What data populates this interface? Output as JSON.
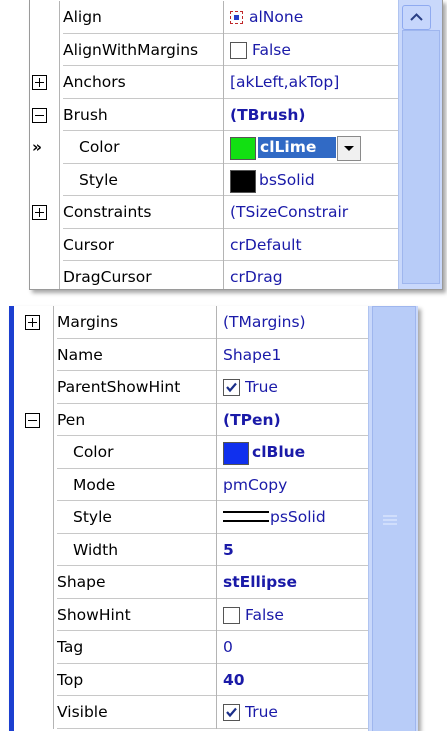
{
  "top_panel": {
    "rows": [
      {
        "name": "Align",
        "value": "alNone",
        "icon": "align-icon"
      },
      {
        "name": "AlignWithMargins",
        "value": "False",
        "checked": false
      },
      {
        "name": "Anchors",
        "value": "[akLeft,akTop]",
        "toggle": "expand"
      },
      {
        "name": "Brush",
        "value": "(TBrush)",
        "toggle": "collapse",
        "bold": true
      },
      {
        "name": "Color",
        "value": "clLime",
        "selected": true,
        "swatch": "#12e012"
      },
      {
        "name": "Style",
        "value": "bsSolid",
        "swatch": "#000000"
      },
      {
        "name": "Constraints",
        "value": "(TSizeConstrair",
        "toggle": "expand"
      },
      {
        "name": "Cursor",
        "value": "crDefault"
      },
      {
        "name": "DragCursor",
        "value": "crDrag"
      }
    ],
    "current_row_marker": "»"
  },
  "bottom_panel": {
    "rows": [
      {
        "name": "Margins",
        "value": "(TMargins)",
        "toggle": "expand"
      },
      {
        "name": "Name",
        "value": "Shape1"
      },
      {
        "name": "ParentShowHint",
        "value": "True",
        "checked": true
      },
      {
        "name": "Pen",
        "value": "(TPen)",
        "toggle": "collapse",
        "bold": true
      },
      {
        "name": "Color",
        "value": "clBlue",
        "swatch": "#1030ee",
        "bold": true
      },
      {
        "name": "Mode",
        "value": "pmCopy"
      },
      {
        "name": "Style",
        "value": "psSolid",
        "icon": "line-style-icon"
      },
      {
        "name": "Width",
        "value": "5",
        "bold": true
      },
      {
        "name": "Shape",
        "value": "stEllipse",
        "bold": true
      },
      {
        "name": "ShowHint",
        "value": "False",
        "checked": false
      },
      {
        "name": "Tag",
        "value": "0"
      },
      {
        "name": "Top",
        "value": "40",
        "bold": true
      },
      {
        "name": "Visible",
        "value": "True",
        "checked": true
      }
    ]
  },
  "colors": {
    "value_text": "#1a1aa8",
    "selection": "#316ac5",
    "scrollbar": "#c9d8fb",
    "accent_border": "#1c3fd0"
  }
}
